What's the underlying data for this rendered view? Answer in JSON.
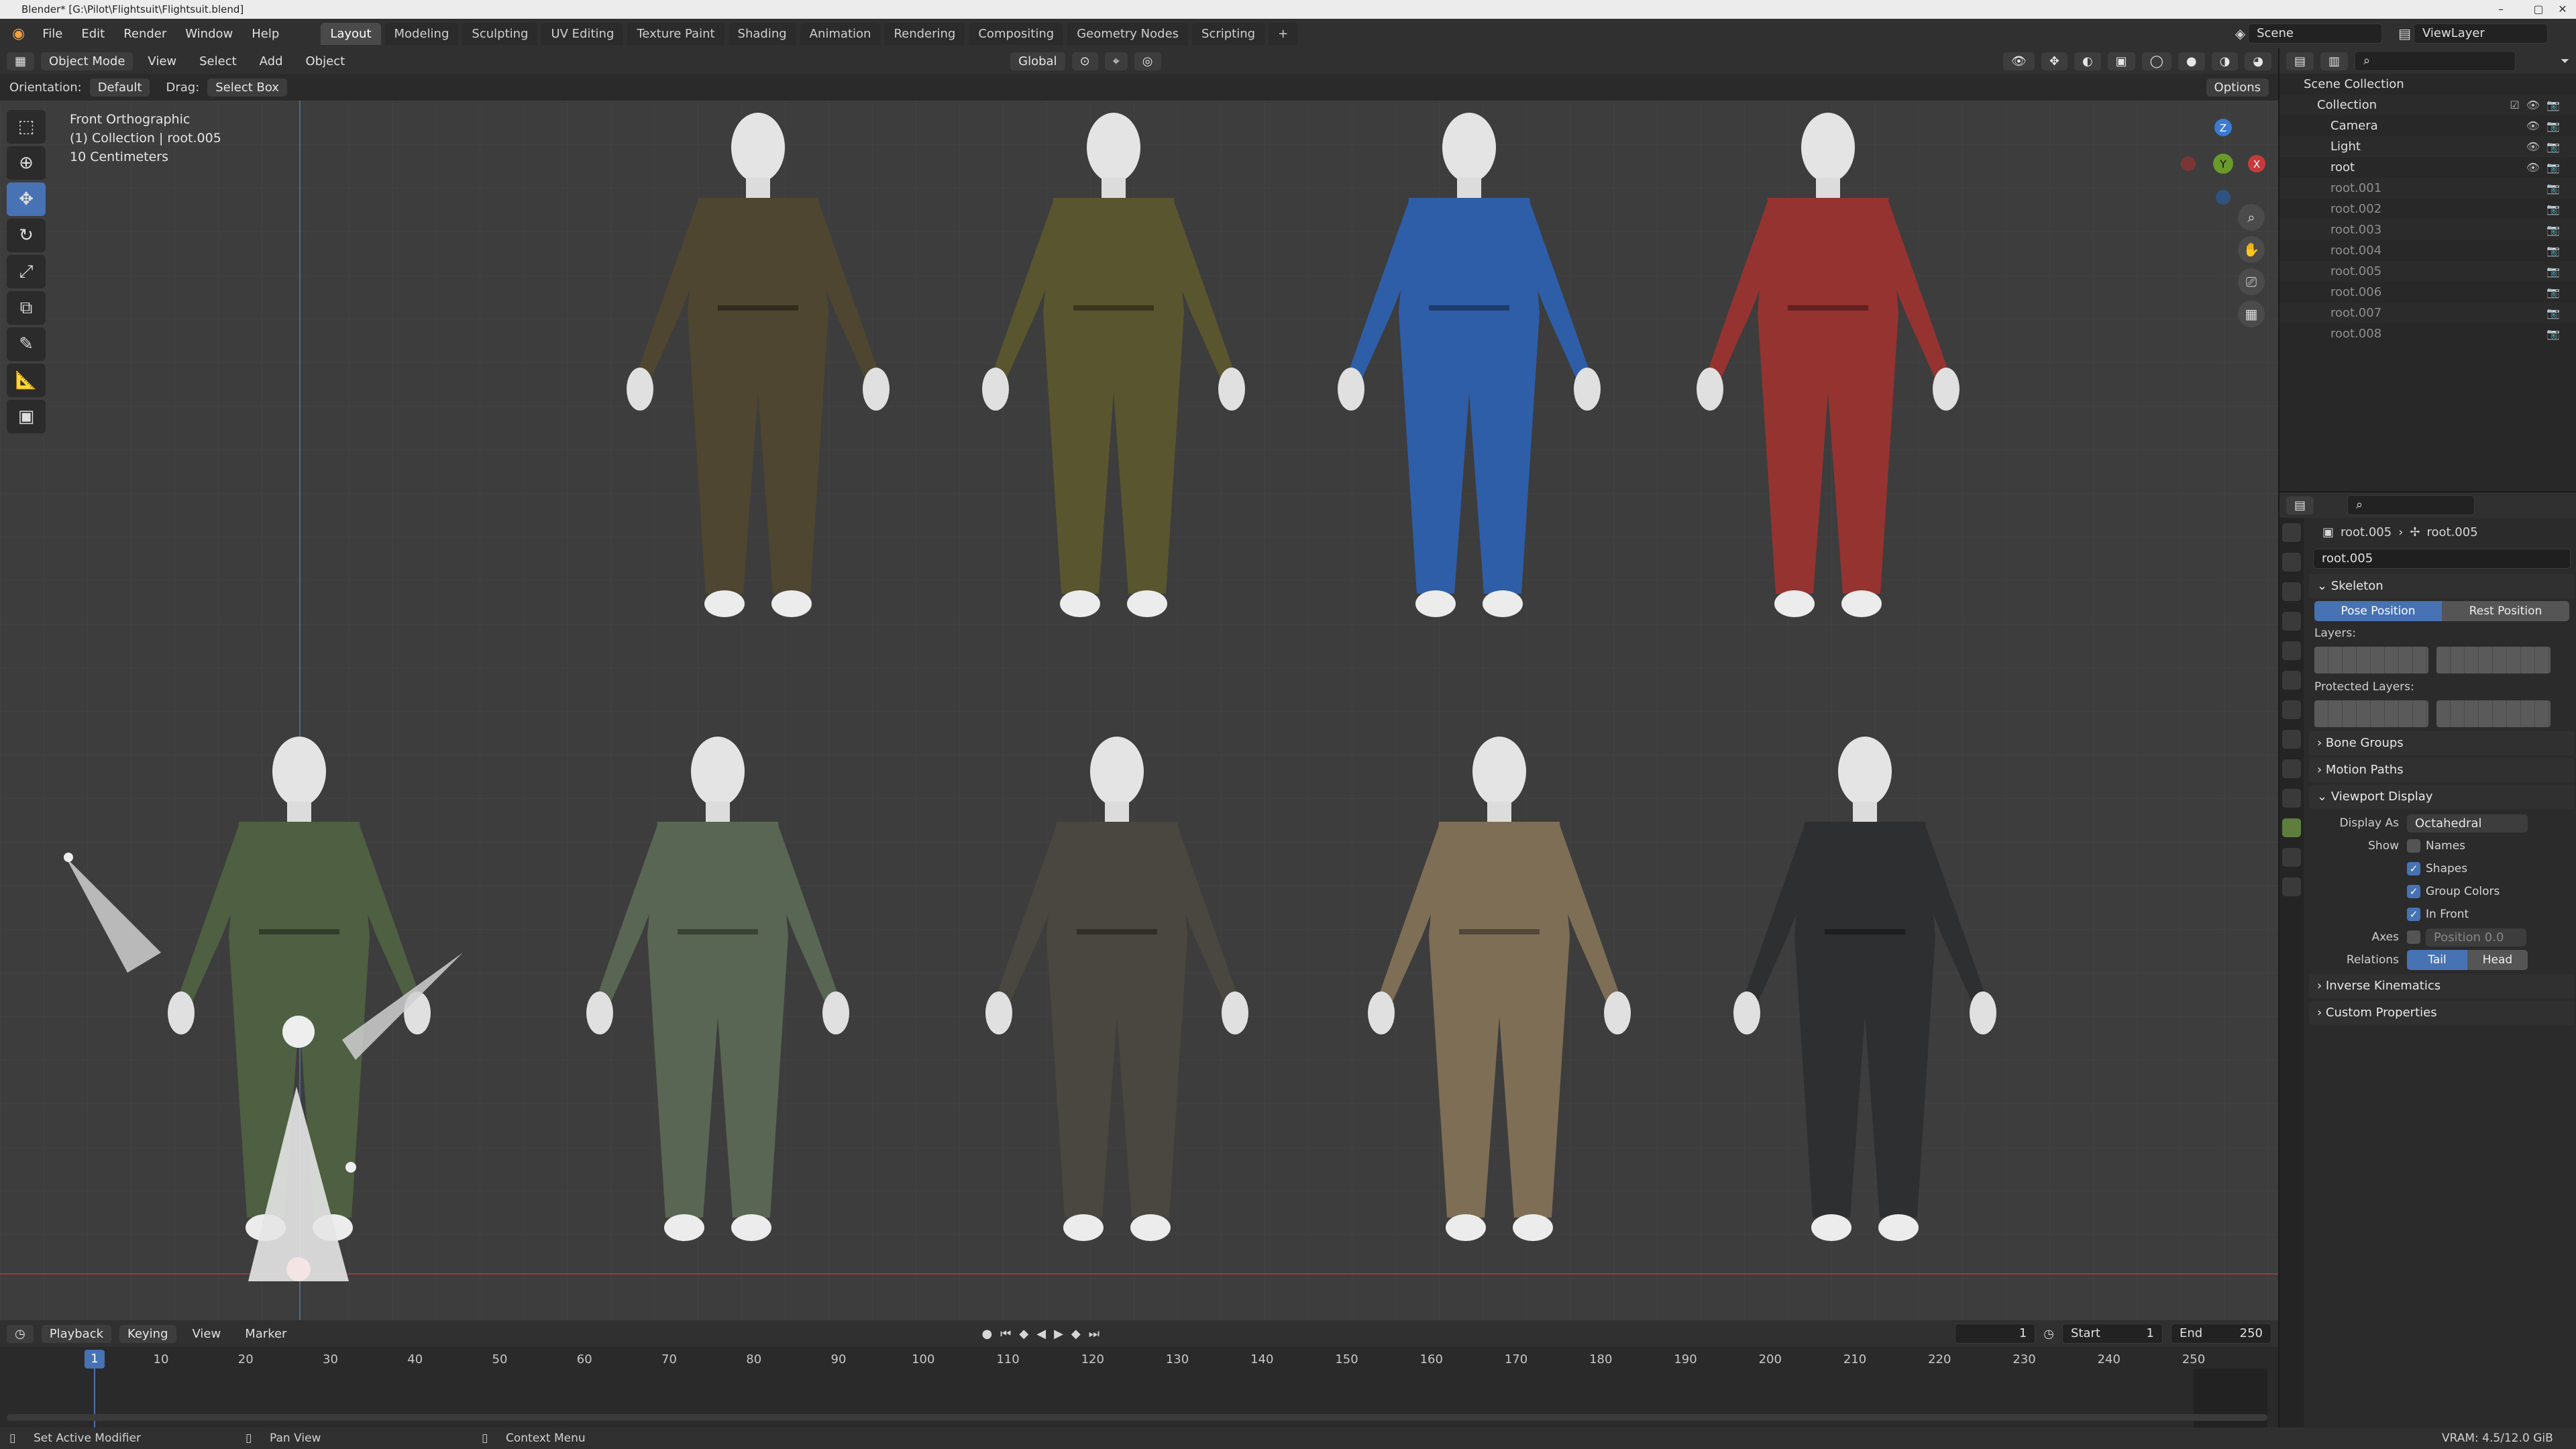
{
  "titlebar": {
    "title": "Blender* [G:\\Pilot\\Flightsuit\\Flightsuit.blend]"
  },
  "menus": [
    "File",
    "Edit",
    "Render",
    "Window",
    "Help"
  ],
  "workspaces": [
    "Layout",
    "Modeling",
    "Sculpting",
    "UV Editing",
    "Texture Paint",
    "Shading",
    "Animation",
    "Rendering",
    "Compositing",
    "Geometry Nodes",
    "Scripting"
  ],
  "active_workspace": "Layout",
  "scene": {
    "scene_name": "Scene",
    "view_layer": "ViewLayer"
  },
  "header3d": {
    "mode": "Object Mode",
    "view": "View",
    "select": "Select",
    "add": "Add",
    "object": "Object",
    "transform": "Global"
  },
  "tool_settings": {
    "orientation_label": "Orientation:",
    "orientation_value": "Default",
    "drag_label": "Drag:",
    "drag_value": "Select Box",
    "options": "Options"
  },
  "viewport": {
    "line1": "Front Orthographic",
    "line2": "(1) Collection | root.005",
    "line3": "10 Centimeters"
  },
  "gizmo": {
    "z": "Z",
    "y": "Y",
    "x": "X"
  },
  "suits": [
    {
      "color": "#4e4630"
    },
    {
      "color": "#59552f"
    },
    {
      "color": "#2f5ea8"
    },
    {
      "color": "#953331"
    },
    {
      "color": "#4e5f42"
    },
    {
      "color": "#596653"
    },
    {
      "color": "#4a4740"
    },
    {
      "color": "#7e6e56"
    },
    {
      "color": "#2d2f31"
    }
  ],
  "outliner": {
    "header": "Scene Collection",
    "items": [
      {
        "name": "Collection"
      },
      {
        "name": "Camera"
      },
      {
        "name": "Light"
      },
      {
        "name": "root"
      },
      {
        "name": "root.001"
      },
      {
        "name": "root.002"
      },
      {
        "name": "root.003"
      },
      {
        "name": "root.004"
      },
      {
        "name": "root.005"
      },
      {
        "name": "root.006"
      },
      {
        "name": "root.007"
      },
      {
        "name": "root.008"
      }
    ]
  },
  "properties": {
    "breadcrumb_obj": "root.005",
    "breadcrumb_data": "root.005",
    "datablock": "root.005",
    "skeleton": "Skeleton",
    "pose_position": "Pose Position",
    "rest_position": "Rest Position",
    "layers": "Layers:",
    "protected_layers": "Protected Layers:",
    "bone_groups": "Bone Groups",
    "motion_paths": "Motion Paths",
    "viewport_display": "Viewport Display",
    "display_as_label": "Display As",
    "display_as_value": "Octahedral",
    "show_label": "Show",
    "names": "Names",
    "shapes": "Shapes",
    "group_colors": "Group Colors",
    "in_front": "In Front",
    "axes_label": "Axes",
    "axes_position": "Position  0.0",
    "relations_label": "Relations",
    "tail": "Tail",
    "head": "Head",
    "inverse_kinematics": "Inverse Kinematics",
    "custom_properties": "Custom Properties"
  },
  "timeline": {
    "playback": "Playback",
    "keying": "Keying",
    "view": "View",
    "marker": "Marker",
    "current_frame": "1",
    "start_label": "Start",
    "start": "1",
    "end_label": "End",
    "end": "250",
    "current_marker": "1",
    "ticks": [
      "10",
      "20",
      "30",
      "40",
      "50",
      "60",
      "70",
      "80",
      "90",
      "100",
      "110",
      "120",
      "130",
      "140",
      "150",
      "160",
      "170",
      "180",
      "190",
      "200",
      "210",
      "220",
      "230",
      "240",
      "250"
    ]
  },
  "statusbar": {
    "left": "Set Active Modifier",
    "mid": "Pan View",
    "right": "Context Menu",
    "vram": "VRAM: 4.5/12.0 GiB"
  }
}
